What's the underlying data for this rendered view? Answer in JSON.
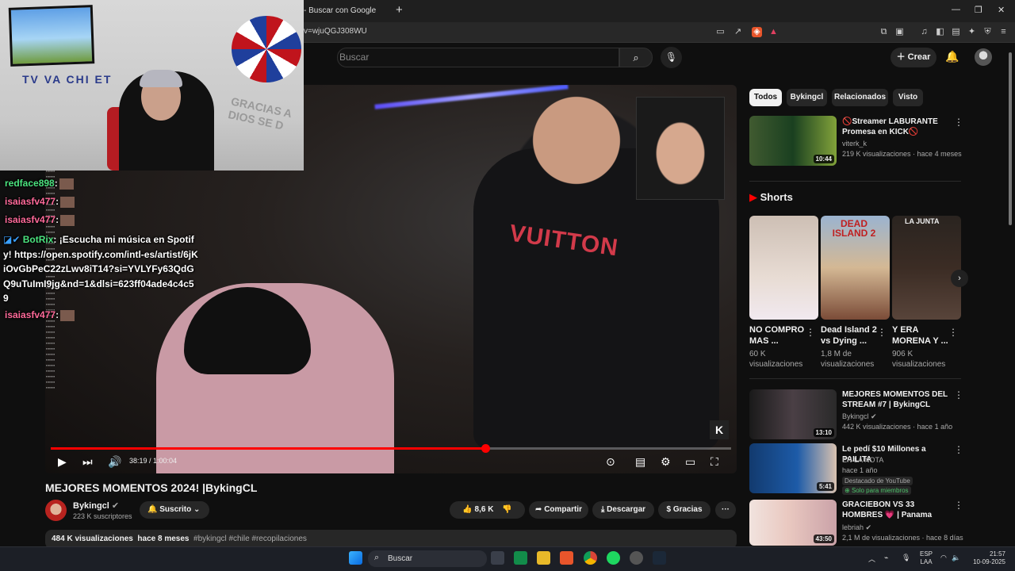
{
  "browser": {
    "tab_title": "- Buscar con Google",
    "new_tab": "+",
    "url": "v=wjuQGJ308WU",
    "win_min": "—",
    "win_max": "❐",
    "win_close": "✕"
  },
  "header": {
    "search_placeholder": "Buscar",
    "create_label": "Crear"
  },
  "stream": {
    "cam_text": "TV VA CHI ET",
    "sign_text": "GRACIAS A DIOS SE D",
    "chat": [
      {
        "user": "redface898",
        "color": "#4be37f",
        "msg": ":"
      },
      {
        "user": "isaiasfv477",
        "color": "#ff6a9a",
        "msg": ":"
      },
      {
        "user": "isaiasfv477",
        "color": "#ff6a9a",
        "msg": ":"
      },
      {
        "user": "BotRix",
        "color": "#4be37f",
        "msg": ": ¡Escucha mi música en Spotify! https://open.spotify.com/intl-es/artist/6jKiOvGbPeC22zLwv8iT14?si=YVLYFy63QdGQ9uTuImI9jg&nd=1&dlsi=623ff04ade4c4c59"
      },
      {
        "user": "isaiasfv477",
        "color": "#ff6a9a",
        "msg": ":"
      }
    ]
  },
  "player": {
    "time": "38:19 / 1:00:04",
    "progress": 0.6384,
    "logo": "K"
  },
  "video": {
    "title": "MEJORES MOMENTOS 2024! |BykingCL",
    "channel": "Bykingcl",
    "subscribers": "223 K suscriptores",
    "subscribed_label": "Suscrito",
    "likes": "8,6 K",
    "share": "Compartir",
    "download": "Descargar",
    "thanks": "Gracias",
    "more": "···",
    "views": "484 K visualizaciones",
    "date": "hace 8 meses",
    "tags": "#bykingcl #chile #recopilaciones"
  },
  "chips": [
    "Todos",
    "Bykingcl",
    "Relacionados",
    "Visto"
  ],
  "shorts_label": "Shorts",
  "recommended_top": {
    "title": "🚫Streamer LABURANTE Promesa en KICK🚫",
    "channel": "viterk_k",
    "meta": "219 K visualizaciones · hace 4 meses",
    "duration": "10:44"
  },
  "shorts": [
    {
      "title": "NO COMPRO MAS ...",
      "meta": "60 K visualizaciones",
      "overlay": ""
    },
    {
      "title": "Dead Island 2 vs Dying ...",
      "meta": "1,8 M de visualizaciones",
      "overlay": "DEAD ISLAND 2"
    },
    {
      "title": "Y ERA MORENA Y ...",
      "meta": "906 K visualizaciones",
      "overlay": "LA JUNTA"
    }
  ],
  "recommended": [
    {
      "title": "MEJORES MOMENTOS DEL STREAM #7 | BykingCL",
      "channel": "Bykingcl",
      "meta": "442 K visualizaciones · hace 1 año",
      "duration": "13:10",
      "badge1": "",
      "badge2": ""
    },
    {
      "title": "Le pedí $10 Millones a PAILITA",
      "channel": "EN LA NOTA",
      "meta": "hace 1 año",
      "duration": "5:41",
      "badge1": "Destacado de YouTube",
      "badge2": "Solo para miembros"
    },
    {
      "title": "GRACIEBON VS 33 HOMBRES 💗 | Panama",
      "channel": "lebriah",
      "meta": "2,1 M de visualizaciones · hace 8 días",
      "duration": "43:50",
      "badge1": "",
      "badge2": ""
    }
  ],
  "taskbar": {
    "search": "Buscar",
    "lang1": "ESP",
    "lang2": "LAA",
    "time": "21:57",
    "date": "10-09-2025"
  }
}
